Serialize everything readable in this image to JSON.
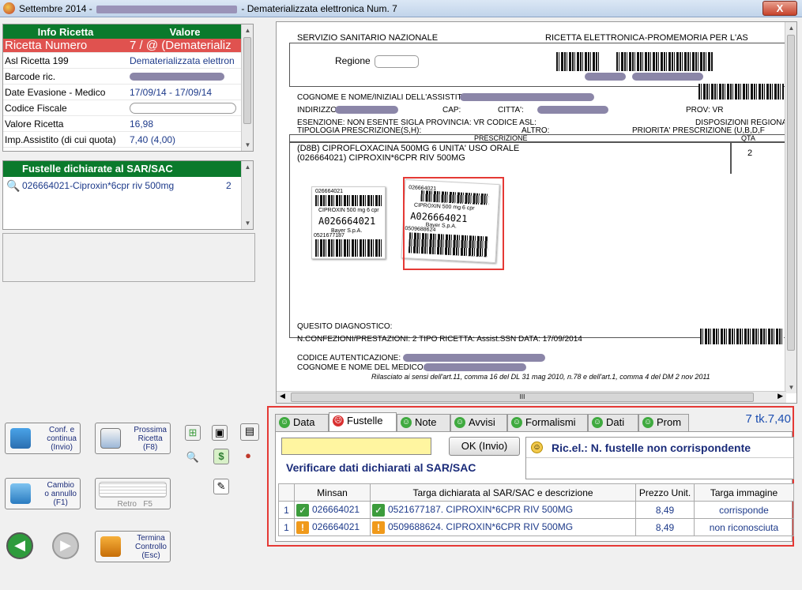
{
  "window": {
    "title_prefix": "Settembre 2014 -",
    "title_suffix": "- Dematerializzata elettronica Num. 7",
    "close_label": "X"
  },
  "info_table": {
    "header_left": "Info Ricetta",
    "header_right": "Valore",
    "rows": [
      {
        "label": "Ricetta Numero",
        "value": "7 / @ (Dematerializ"
      },
      {
        "label": "Asl Ricetta 199",
        "value": "Dematerializzata elettron"
      },
      {
        "label": "Barcode ric.",
        "value": ""
      },
      {
        "label": "Date Evasione - Medico",
        "value": "17/09/14 - 17/09/14"
      },
      {
        "label": "Codice Fiscale",
        "value": ""
      },
      {
        "label": "Valore Ricetta",
        "value": "16,98"
      },
      {
        "label": "Imp.Assistito (di cui quota)",
        "value": "7,40 (4,00)"
      }
    ]
  },
  "fustelle": {
    "header": "Fustelle dichiarate al SAR/SAC",
    "item_text": "026664021-Ciproxin*6cpr riv 500mg",
    "item_qty": "2"
  },
  "document": {
    "ssn": "SERVIZIO SANITARIO NAZIONALE",
    "title": "RICETTA ELETTRONICA-PROMEMORIA PER L'AS",
    "regione": "Regione",
    "cognome": "COGNOME E NOME/INIZIALI DELL'ASSISTITO:",
    "indirizzo": "INDIRIZZO:",
    "cap": "CAP:",
    "citta": "CITTA':",
    "prov": "PROV: VR",
    "esenzione": "ESENZIONE: NON ESENTE     SIGLA PROVINCIA: VR   CODICE ASL:",
    "disposizioni": "DISPOSIZIONI REGIONALI",
    "tipologia": "TIPOLOGIA PRESCRIZIONE(S,H):",
    "altro": "ALTRO:",
    "priorita": "PRIORITA' PRESCRIZIONE (U,B,D,F",
    "prescrizione": "PRESCRIZIONE",
    "qta": "QTA",
    "drug_line1": "(D8B) CIPROFLOXACINA 500MG 6 UNITA' USO ORALE",
    "drug_line2": "(026664021) CIPROXIN*6CPR RIV 500MG",
    "drug_qty": "2",
    "sticker1_code": "026664021",
    "sticker1_name": "CIPROXIN 500 mg 6 cpr",
    "sticker1_big": "A026664021",
    "sticker1_maker": "Bayer S.p.A.",
    "sticker1_small": "0521677187",
    "sticker2_code": "026664021",
    "sticker2_name": "CIPROXIN 500 mg 6 cpr",
    "sticker2_big": "A026664021",
    "sticker2_maker": "Bayer S.p.A.",
    "sticker2_small": "0509688624",
    "quesito": "QUESITO DIAGNOSTICO:",
    "nconf": "N.CONFEZIONI/PRESTAZIONI: 2     TIPO RICETTA: Assist.SSN   DATA: 17/09/2014",
    "codice_aut": "CODICE AUTENTICAZIONE:",
    "medico": "COGNOME E NOME DEL MEDICO:",
    "footer": "Rilasciato ai sensi dell'art.11, comma 16 del DL 31 mag 2010, n.78 e dell'art.1, comma 4 del DM 2 nov 2011",
    "hscroll_label": "III"
  },
  "buttons": {
    "conf": "Conf. e\ncontinua\n(Invio)",
    "prossima": "Prossima\nRicetta\n(F8)",
    "cambio": "Cambio\no annullo\n(F1)",
    "retro": "Retro   F5",
    "termina": "Termina\nControllo\n(Esc)"
  },
  "tabs": [
    {
      "label": "Data",
      "icon": "smile-green"
    },
    {
      "label": "Fustelle",
      "icon": "smile-red"
    },
    {
      "label": "Note",
      "icon": "smile-green"
    },
    {
      "label": "Avvisi",
      "icon": "smile-green"
    },
    {
      "label": "Formalismi",
      "icon": "smile-green"
    },
    {
      "label": "Dati",
      "icon": "smile-green"
    },
    {
      "label": "Prom",
      "icon": "smile-green"
    }
  ],
  "tk_info": "7 tk.7,40",
  "ok_button": "OK (Invio)",
  "message": "Ric.el.: N. fustelle non corrispondente",
  "verify_text": "Verificare dati dichiarati al SAR/SAC",
  "grid": {
    "headers": [
      "",
      "Minsan",
      "Targa dichiarata al SAR/SAC e descrizione",
      "Prezzo Unit.",
      "Targa immagine"
    ],
    "rows": [
      {
        "n": "1",
        "status": "ok",
        "minsan": "026664021",
        "targa": "0521677187. CIPROXIN*6CPR RIV 500MG",
        "prezzo": "8,49",
        "immagine": "corrisponde"
      },
      {
        "n": "1",
        "status": "warn",
        "minsan": "026664021",
        "targa": "0509688624. CIPROXIN*6CPR RIV 500MG",
        "prezzo": "8,49",
        "immagine": "non riconosciuta"
      }
    ]
  },
  "colors": {
    "header_green": "#0b7a2c",
    "highlight_red": "#e0524f",
    "annotation_red": "#e53935",
    "value_blue": "#1d3a8a"
  }
}
